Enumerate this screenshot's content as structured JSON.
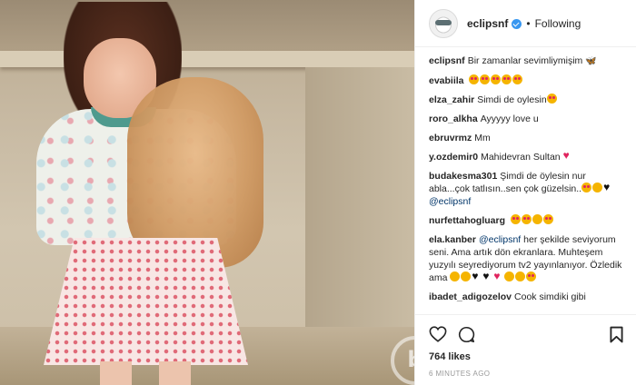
{
  "post": {
    "username": "eclipsnf",
    "separator": "•",
    "follow_status": "Following"
  },
  "comments": [
    {
      "user": "eclipsnf",
      "text": "Bir zamanlar sevimliymişim"
    },
    {
      "user": "evabiila",
      "text": ""
    },
    {
      "user": "elza_zahir",
      "text": "Simdi de oylesin"
    },
    {
      "user": "roro_alkha",
      "text": "Ayyyyy love u"
    },
    {
      "user": "ebruvrmz",
      "text": "Mm"
    },
    {
      "user": "y.ozdemir0",
      "text": "Mahidevran Sultan"
    },
    {
      "user": "budakesma301",
      "text": "Şimdi de öylesin nur abla...çok tatlısın..sen çok güzelsin..",
      "mention": "@eclipsnf"
    },
    {
      "user": "nurfettahogluarg",
      "text": ""
    },
    {
      "user": "ela.kanber",
      "mention": "@eclipsnf",
      "text": "her şekilde seviyorum seni. Ama artık dön ekranlara. Muhteşem yuzyılı seyrediyorum tv2 yayınlanıyor. Özledik ama"
    },
    {
      "user": "ibadet_adigozelov",
      "text": "Cook simdiki gibi"
    }
  ],
  "stats": {
    "likes": "764 likes",
    "time": "6 MINUTES AGO"
  },
  "icons": {
    "like": "heart-outline-icon",
    "comment": "speech-bubble-icon",
    "save": "bookmark-icon",
    "verified": "verified-badge-icon"
  },
  "colors": {
    "verified": "#3897f0",
    "text": "#262626",
    "mention": "#003569",
    "muted": "#999999"
  }
}
